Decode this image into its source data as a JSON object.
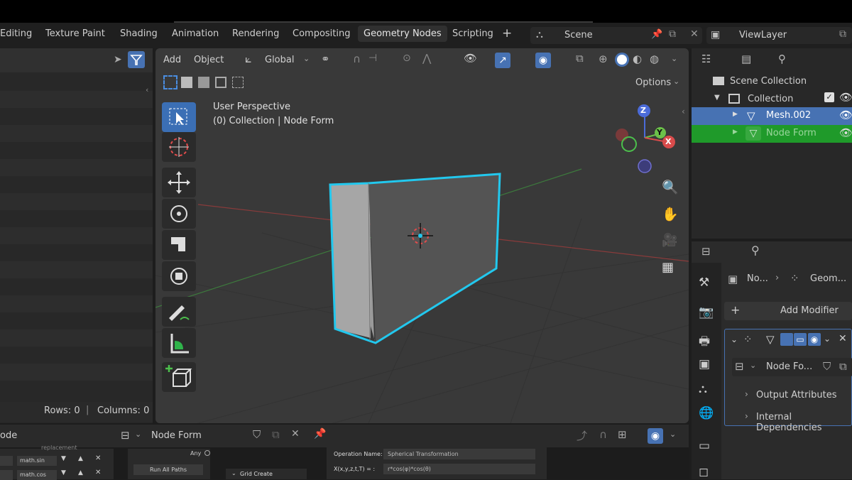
{
  "workspace_tabs": [
    "Editing",
    "Texture Paint",
    "Shading",
    "Animation",
    "Rendering",
    "Compositing",
    "Geometry Nodes",
    "Scripting"
  ],
  "active_tab": "Geometry Nodes",
  "add_workspace": "+",
  "scene": {
    "name": "Scene"
  },
  "view_layer": {
    "name": "ViewLayer"
  },
  "spreadsheet": {
    "rows_label": "Rows: 0",
    "columns_label": "Columns: 0"
  },
  "viewport": {
    "menu_add": "Add",
    "menu_object": "Object",
    "orientation": "Global",
    "options": "Options",
    "perspective": "User Perspective",
    "context": "(0) Collection | Node Form"
  },
  "gizmo": {
    "z": "Z",
    "y": "Y",
    "x": "X"
  },
  "outliner": {
    "root": "Scene Collection",
    "collection": "Collection",
    "items": [
      {
        "label": "Mesh.002",
        "state": "selected"
      },
      {
        "label": "Node Form",
        "state": "active"
      }
    ]
  },
  "properties": {
    "breadcrumb_object": "No...",
    "breadcrumb_modifier": "Geom...",
    "add_modifier": "Add Modifier",
    "node_group": "Node Fo...",
    "sections": [
      "Output Attributes",
      "Internal Dependencies"
    ]
  },
  "node_editor": {
    "editor_label": "ode",
    "node_group_name": "Node Form",
    "left_rows": [
      "math.sin",
      "math.cos"
    ],
    "any_label": "Any",
    "run_all": "Run All Paths",
    "grid_create": "Grid Create",
    "operation_name_label": "Operation Name:",
    "operation_name_value": "Spherical Transformation",
    "formula_label": "X(x,y,z,t,T) = :",
    "formula_value": "r*cos(φ)*cos(θ)",
    "replacement": "replacement"
  },
  "colors": {
    "accent_blue": "#4772b3",
    "selection_cyan": "#22c8ee",
    "active_green": "#1f9a2a"
  }
}
